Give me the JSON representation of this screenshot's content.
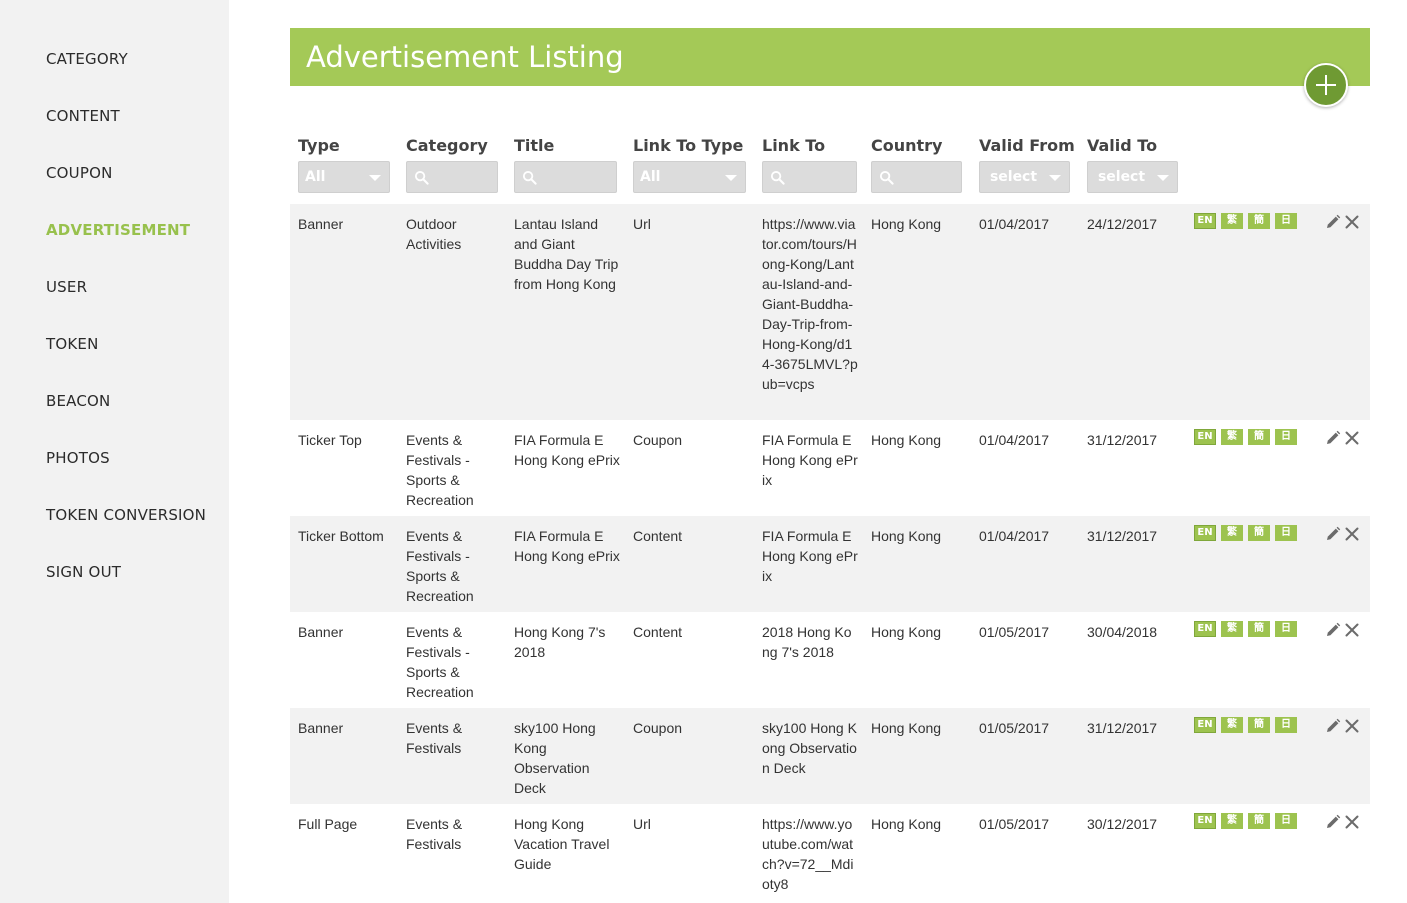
{
  "sidebar": {
    "items": [
      {
        "label": "CATEGORY",
        "active": false
      },
      {
        "label": "CONTENT",
        "active": false
      },
      {
        "label": "COUPON",
        "active": false
      },
      {
        "label": "ADVERTISEMENT",
        "active": true
      },
      {
        "label": "USER",
        "active": false
      },
      {
        "label": "TOKEN",
        "active": false
      },
      {
        "label": "BEACON",
        "active": false
      },
      {
        "label": "PHOTOS",
        "active": false
      },
      {
        "label": "TOKEN CONVERSION",
        "active": false
      },
      {
        "label": "SIGN OUT",
        "active": false
      }
    ]
  },
  "header": {
    "title": "Advertisement Listing",
    "add_icon": "plus-icon"
  },
  "table": {
    "columns": [
      "Type",
      "Category",
      "Title",
      "Link To Type",
      "Link To",
      "Country",
      "Valid From",
      "Valid To"
    ],
    "filters": {
      "type": "All",
      "category": "",
      "title": "",
      "link_to_type": "All",
      "link_to": "",
      "country": "",
      "valid_from": "select",
      "valid_to": "select"
    },
    "languages": [
      "EN",
      "繁",
      "簡",
      "日"
    ],
    "rows": [
      {
        "type": "Banner",
        "category": "Outdoor Activities",
        "title": "Lantau Island and Giant Buddha Day Trip from Hong Kong",
        "link_to_type": "Url",
        "link_to": "https://www.viator.com/tours/Hong-Kong/Lantau-Island-and-Giant-Buddha-Day-Trip-from-Hong-Kong/d14-3675LMVL?pub=vcps",
        "country": "Hong Kong",
        "valid_from": "01/04/2017",
        "valid_to": "24/12/2017"
      },
      {
        "type": "Ticker Top",
        "category": "Events & Festivals - Sports & Recreation",
        "title": "FIA Formula E Hong Kong ePrix",
        "link_to_type": "Coupon",
        "link_to": "FIA Formula E Hong Kong ePrix",
        "country": "Hong Kong",
        "valid_from": "01/04/2017",
        "valid_to": "31/12/2017"
      },
      {
        "type": "Ticker Bottom",
        "category": "Events & Festivals - Sports & Recreation",
        "title": "FIA Formula E Hong Kong ePrix",
        "link_to_type": "Content",
        "link_to": "FIA Formula E Hong Kong ePrix",
        "country": "Hong Kong",
        "valid_from": "01/04/2017",
        "valid_to": "31/12/2017"
      },
      {
        "type": "Banner",
        "category": "Events & Festivals - Sports & Recreation",
        "title": "Hong Kong 7's 2018",
        "link_to_type": "Content",
        "link_to": "2018 Hong Kong 7's 2018",
        "country": "Hong Kong",
        "valid_from": "01/05/2017",
        "valid_to": "30/04/2018"
      },
      {
        "type": "Banner",
        "category": "Events & Festivals",
        "title": "sky100 Hong Kong Observation Deck",
        "link_to_type": "Coupon",
        "link_to": "sky100 Hong Kong Observation Deck",
        "country": "Hong Kong",
        "valid_from": "01/05/2017",
        "valid_to": "31/12/2017"
      },
      {
        "type": "Full Page",
        "category": "Events & Festivals",
        "title": "Hong Kong Vacation Travel Guide",
        "link_to_type": "Url",
        "link_to": "https://www.youtube.com/watch?v=72__Mdioty8",
        "country": "Hong Kong",
        "valid_from": "01/05/2017",
        "valid_to": "30/12/2017"
      }
    ],
    "row_icons": {
      "edit": "pencil-icon",
      "delete": "close-icon"
    },
    "search_icon": "search-icon"
  },
  "colors": {
    "accent": "#a4c957",
    "accent_dark": "#6f9a33",
    "active_nav": "#98c14d",
    "sidebar_bg": "#f2f2f2",
    "row_stripe": "#f2f2f2",
    "filter_bg": "#dcdcdc"
  }
}
